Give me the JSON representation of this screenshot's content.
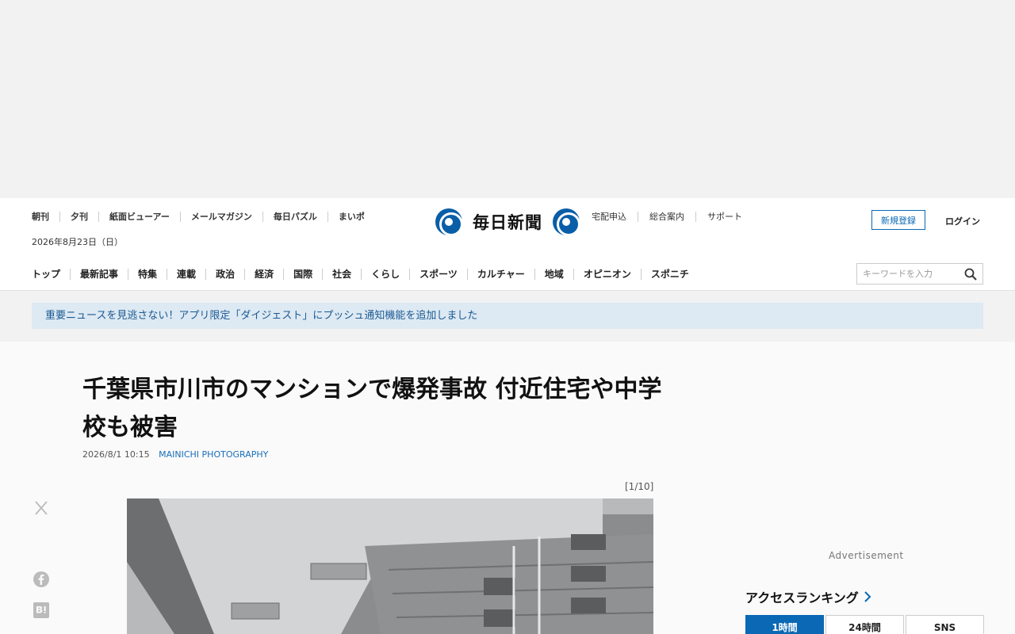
{
  "header": {
    "util_nav": [
      "朝刊",
      "夕刊",
      "紙面ビューアー",
      "メールマガジン",
      "毎日パズル",
      "まいポ"
    ],
    "date": "2026年8月23日（日）",
    "logo_text": "毎日新聞",
    "right_util": [
      "宅配申込",
      "総合案内",
      "サポート"
    ],
    "signup_label": "新規登録",
    "login_label": "ログイン",
    "main_nav": [
      "トップ",
      "最新記事",
      "特集",
      "連載",
      "政治",
      "経済",
      "国際",
      "社会",
      "くらし",
      "スポーツ",
      "カルチャー",
      "地域",
      "オピニオン",
      "スポニチ"
    ],
    "search_placeholder": "キーワードを入力"
  },
  "notice": "重要ニュースを見逃さない！アプリ限定「ダイジェスト」にプッシュ通知機能を追加しました",
  "article": {
    "title": "千葉県市川市のマンションで爆発事故 付近住宅や中学校も被害",
    "datetime": "2026/8/1 10:15",
    "source": "MAINICHI PHOTOGRAPHY",
    "photo_counter": "[1/10]"
  },
  "sidebar": {
    "ad_label": "Advertisement",
    "ranking_title": "アクセスランキング",
    "ranking_tabs": [
      "1時間",
      "24時間",
      "SNS"
    ]
  },
  "icons": [
    "x-icon",
    "facebook-icon",
    "hatena-bookmark-icon",
    "search-icon",
    "chevron-right-icon"
  ],
  "colors": {
    "accent": "#0a68b4",
    "notice_bg": "#dde9f3",
    "notice_text": "#1b5a92"
  }
}
